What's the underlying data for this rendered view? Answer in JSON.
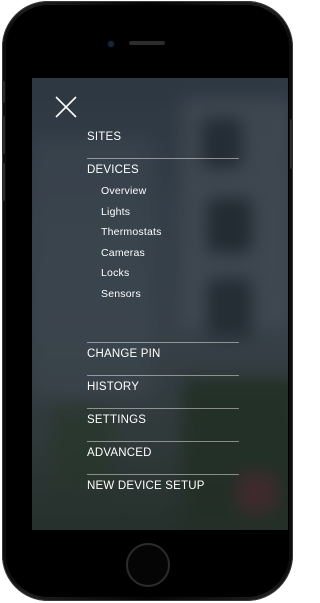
{
  "menu": {
    "sites": "SITES",
    "devices": "DEVICES",
    "device_items": [
      "Overview",
      "Lights",
      "Thermostats",
      "Cameras",
      "Locks",
      "Sensors"
    ],
    "change_pin": "CHANGE PIN",
    "history": "HISTORY",
    "settings": "SETTINGS",
    "advanced": "ADVANCED",
    "new_device_setup": "NEW DEVICE SETUP"
  },
  "icons": {
    "close": "close-icon",
    "home": "home-button-icon"
  },
  "colors": {
    "menu_text": "#ffffff",
    "divider": "#ffffff",
    "device_frame": "#0a0a0a"
  }
}
